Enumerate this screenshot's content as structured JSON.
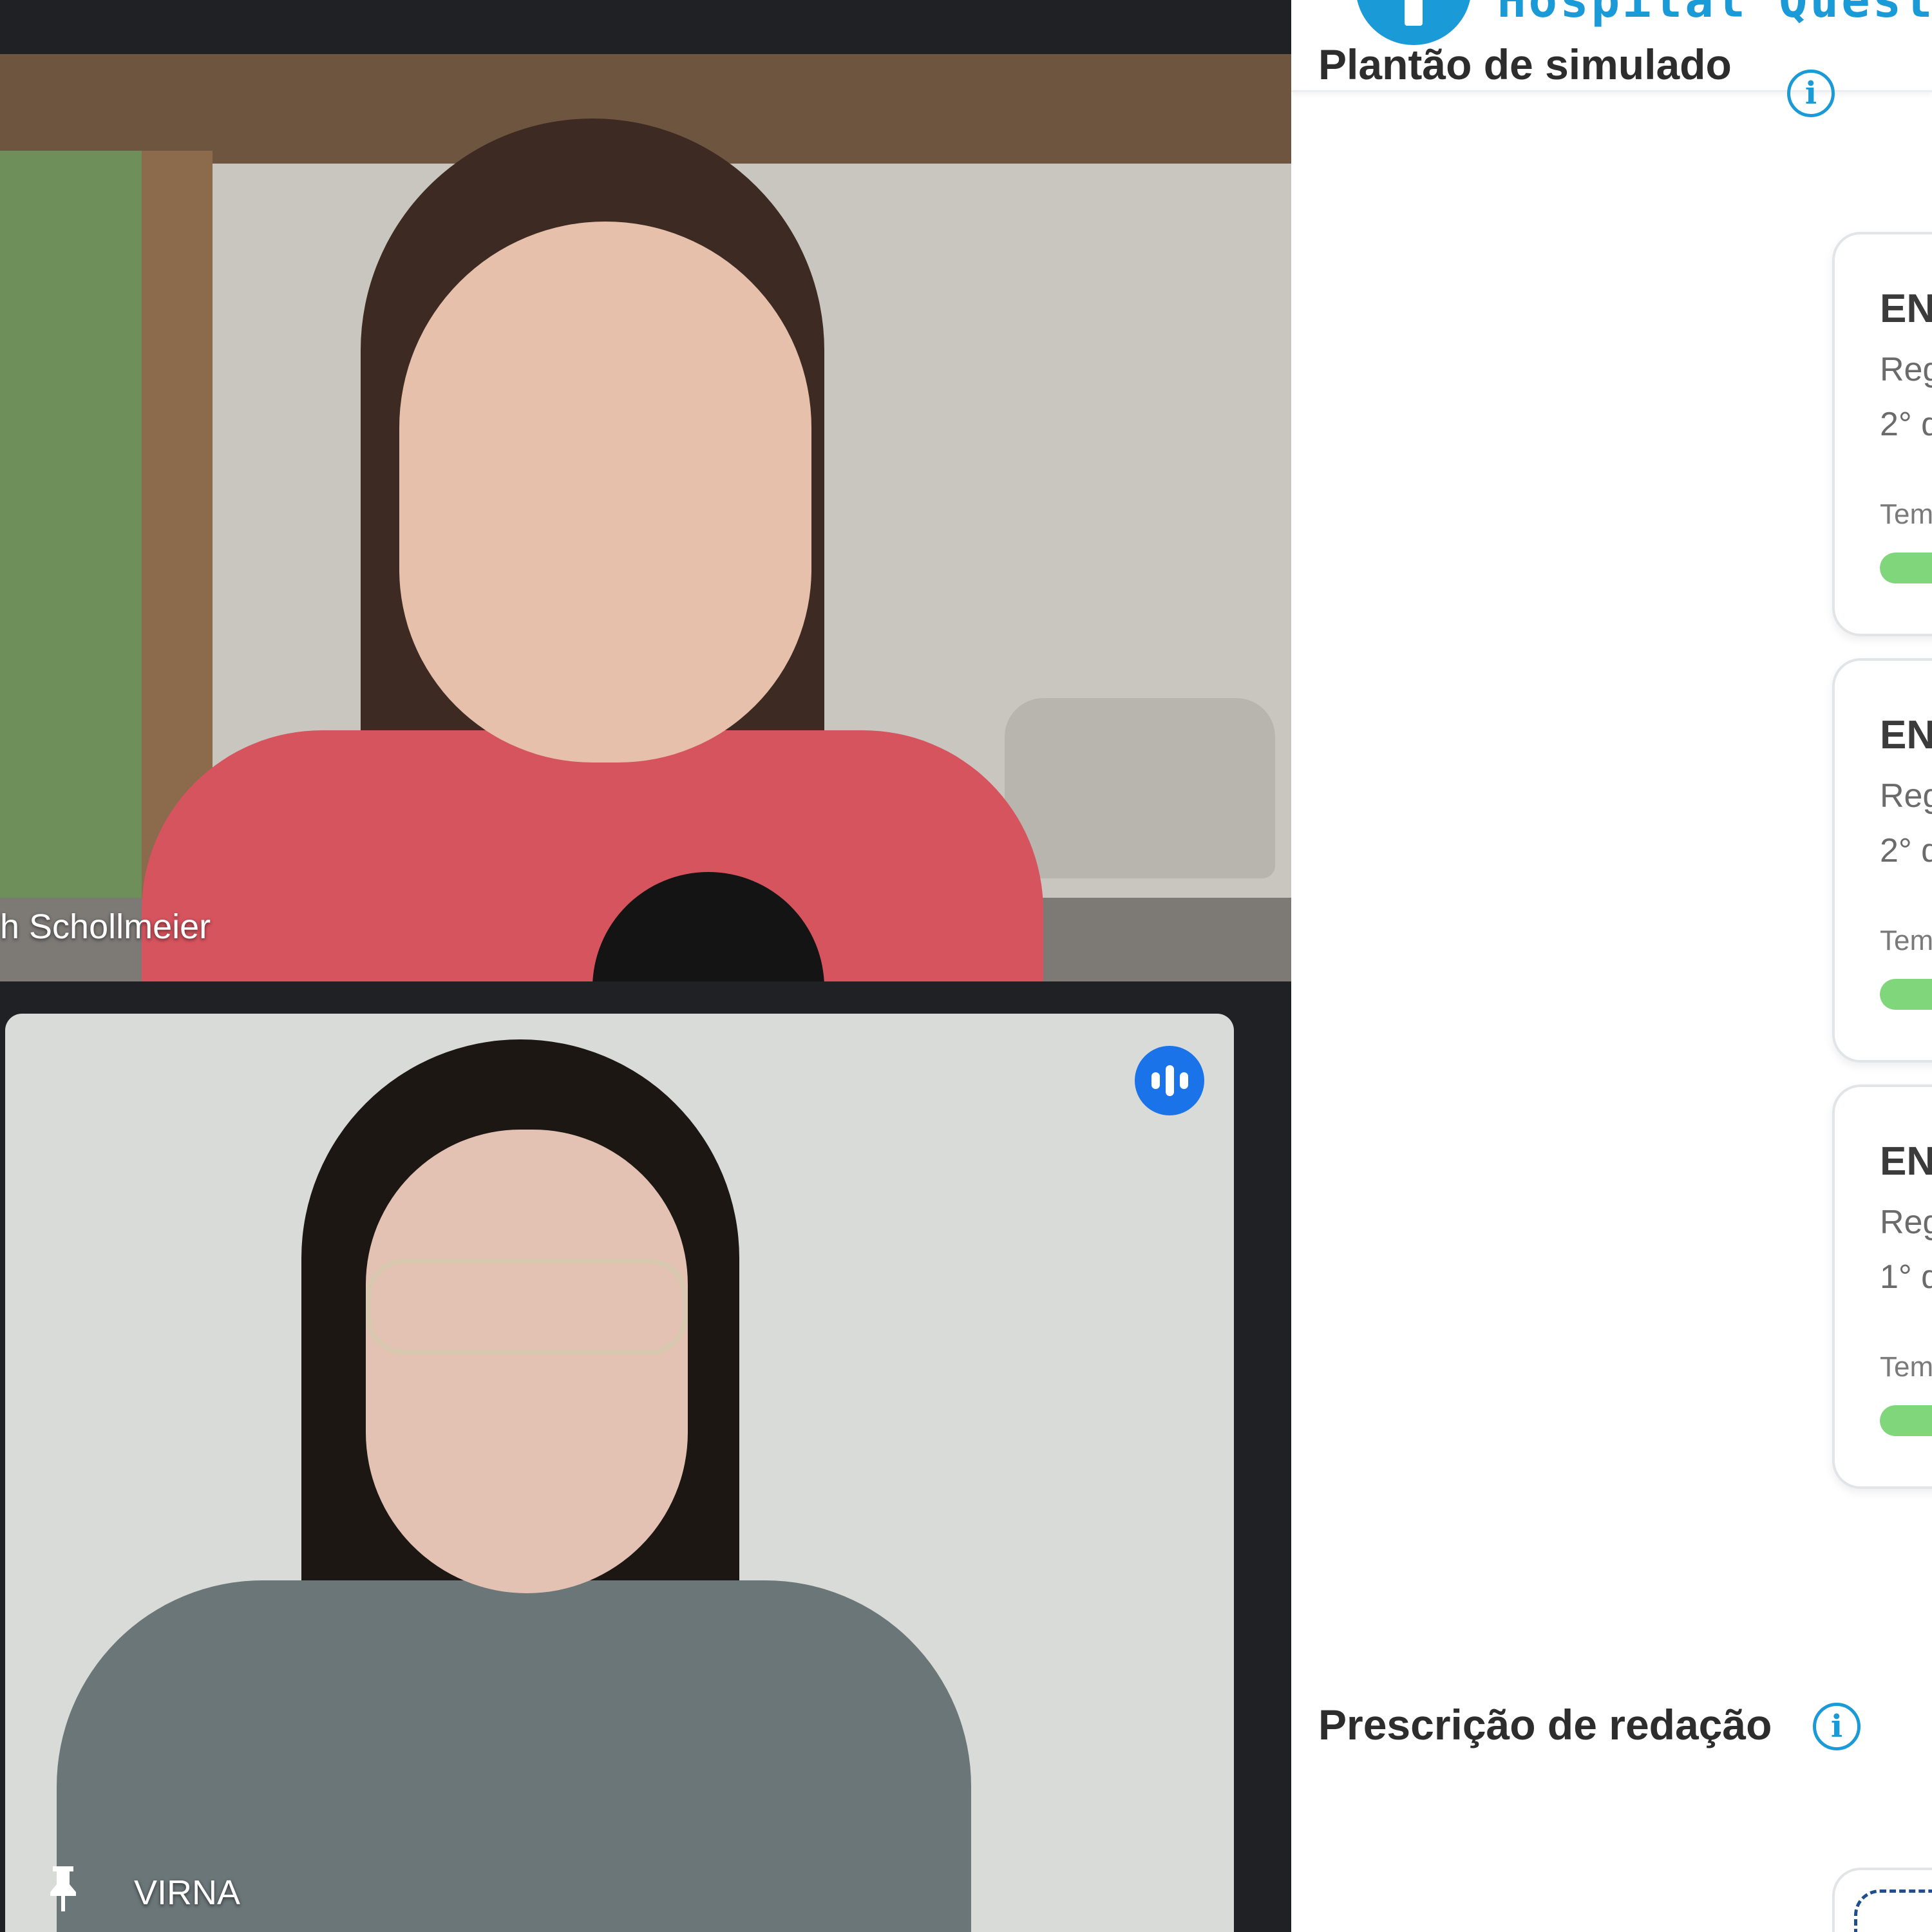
{
  "call": {
    "participants": [
      {
        "name": "h Schollmeier"
      },
      {
        "name": "VIRNA"
      }
    ]
  },
  "shared_screen": {
    "app_title": "Hospital Quest",
    "sections": [
      {
        "title": "Plantão de simulado",
        "cards": [
          {
            "title": "EN",
            "line1": "Reg",
            "line2": "2° d",
            "time_label": "Tem",
            "progress": 1.0
          },
          {
            "title": "EN",
            "line1": "Reg",
            "line2": "2° d",
            "time_label": "Tem",
            "progress": 1.0
          },
          {
            "title": "EN",
            "line1": "Reg",
            "line2": "1° d",
            "time_label": "Tem",
            "progress": 1.0
          }
        ]
      },
      {
        "title": "Prescrição de redação"
      }
    ]
  },
  "colors": {
    "meet_background": "#202124",
    "speaking_indicator": "#1a73e8",
    "accent": "#1a9ad6",
    "progress": "#7fd67b"
  },
  "icons": [
    "speaking-icon",
    "pin-icon",
    "hospital-cross-icon",
    "info-icon"
  ]
}
